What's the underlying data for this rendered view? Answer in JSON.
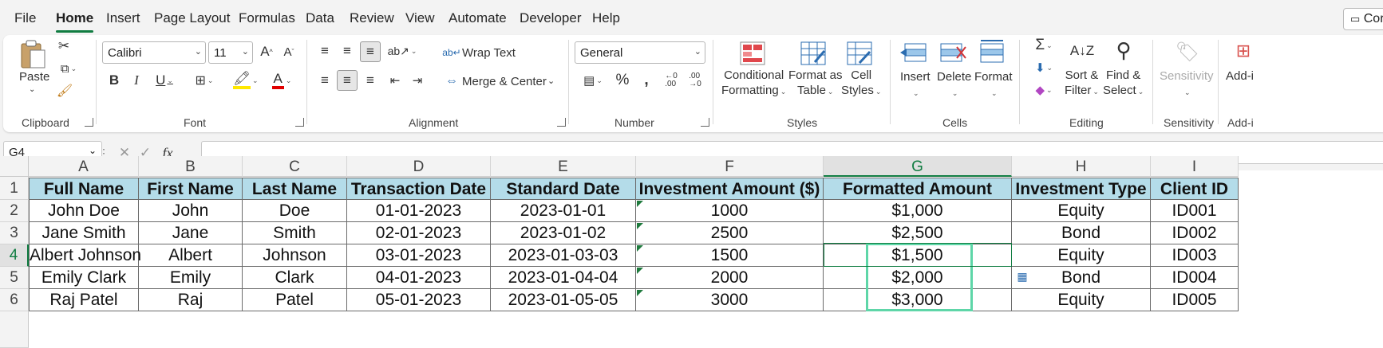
{
  "menu": [
    "File",
    "Home",
    "Insert",
    "Page Layout",
    "Formulas",
    "Data",
    "Review",
    "View",
    "Automate",
    "Developer",
    "Help"
  ],
  "comments_label": "Cor",
  "font": {
    "name": "Calibri",
    "size": "11"
  },
  "number_format": "General",
  "ribbon": {
    "paste": "Paste",
    "wrap_text": "Wrap Text",
    "merge_center": "Merge & Center",
    "cond_fmt_1": "Conditional",
    "cond_fmt_2": "Formatting",
    "format_table_1": "Format as",
    "format_table_2": "Table",
    "cell_styles_1": "Cell",
    "cell_styles_2": "Styles",
    "insert": "Insert",
    "delete": "Delete",
    "format": "Format",
    "sort_filter_1": "Sort &",
    "sort_filter_2": "Filter",
    "find_select_1": "Find &",
    "find_select_2": "Select",
    "sensitivity": "Sensitivity",
    "addins": "Add-i"
  },
  "groups": [
    "Clipboard",
    "Font",
    "Alignment",
    "Number",
    "Styles",
    "Cells",
    "Editing",
    "Sensitivity",
    "Add-i"
  ],
  "name_box": "G4",
  "fx": "fx",
  "columns": [
    "A",
    "B",
    "C",
    "D",
    "E",
    "F",
    "G",
    "H",
    "I"
  ],
  "rows": [
    "1",
    "2",
    "3",
    "4",
    "5",
    "6"
  ],
  "table": [
    [
      "Full Name",
      "First Name",
      "Last Name",
      "Transaction Date",
      "Standard Date",
      "Investment Amount ($)",
      "Formatted Amount",
      "Investment Type",
      "Client ID"
    ],
    [
      "John Doe",
      "John",
      "Doe",
      "01-01-2023",
      "2023-01-01",
      "1000",
      "$1,000",
      "Equity",
      "ID001"
    ],
    [
      "Jane Smith",
      "Jane",
      "Smith",
      "02-01-2023",
      "2023-01-02",
      "2500",
      "$2,500",
      "Bond",
      "ID002"
    ],
    [
      "Albert Johnson",
      "Albert",
      "Johnson",
      "03-01-2023",
      "2023-01-03-03",
      "1500",
      "$1,500",
      "Equity",
      "ID003"
    ],
    [
      "Emily Clark",
      "Emily",
      "Clark",
      "04-01-2023",
      "2023-01-04-04",
      "2000",
      "$2,000",
      "Bond",
      "ID004"
    ],
    [
      "Raj Patel",
      "Raj",
      "Patel",
      "05-01-2023",
      "2023-01-05-05",
      "3000",
      "$3,000",
      "Equity",
      "ID005"
    ]
  ],
  "colors": {
    "accent": "#107c41",
    "header_fill": "#b4dce9",
    "highlight": "#5ed6a8"
  }
}
